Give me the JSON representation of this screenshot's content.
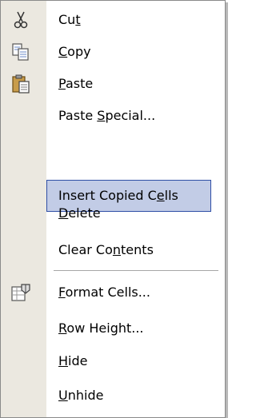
{
  "menu": {
    "items": [
      {
        "name": "cut",
        "pre": "Cu",
        "acc": "t",
        "post": "",
        "icon": "scissors-icon"
      },
      {
        "name": "copy",
        "pre": "",
        "acc": "C",
        "post": "opy",
        "icon": "copy-icon"
      },
      {
        "name": "paste",
        "pre": "",
        "acc": "P",
        "post": "aste",
        "icon": "clipboard-icon"
      },
      {
        "name": "paste-special",
        "pre": "Paste ",
        "acc": "S",
        "post": "pecial...",
        "icon": ""
      },
      {
        "name": "insert-copied-cells",
        "pre": "Insert Copied C",
        "acc": "e",
        "post": "lls",
        "icon": ""
      },
      {
        "name": "delete",
        "pre": "",
        "acc": "D",
        "post": "elete",
        "icon": ""
      },
      {
        "name": "clear-contents",
        "pre": "Clear Co",
        "acc": "n",
        "post": "tents",
        "icon": ""
      },
      {
        "name": "format-cells",
        "pre": "",
        "acc": "F",
        "post": "ormat Cells...",
        "icon": "format-cells-icon"
      },
      {
        "name": "row-height",
        "pre": "",
        "acc": "R",
        "post": "ow Height...",
        "icon": ""
      },
      {
        "name": "hide",
        "pre": "",
        "acc": "H",
        "post": "ide",
        "icon": ""
      },
      {
        "name": "unhide",
        "pre": "",
        "acc": "U",
        "post": "nhide",
        "icon": ""
      }
    ],
    "highlighted_item": "insert-copied-cells",
    "colors": {
      "gutter": "#ebe8e0",
      "highlight_fill": "#c2cce6",
      "highlight_border": "#2f4fa6"
    }
  }
}
